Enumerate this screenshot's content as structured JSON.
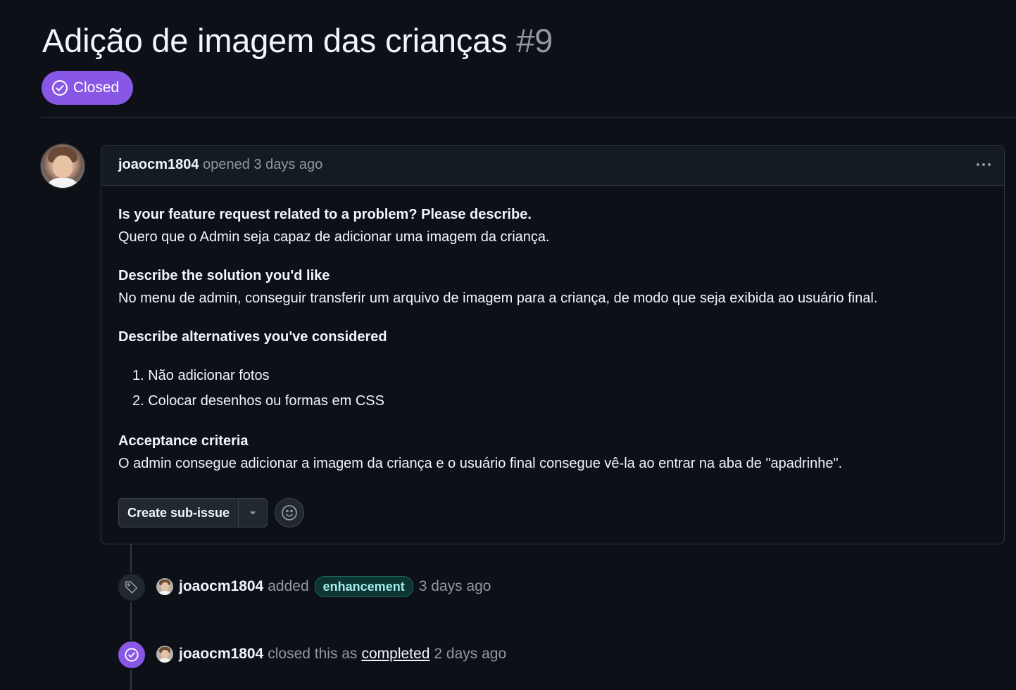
{
  "issue": {
    "title": "Adição de imagem das crianças",
    "number": "#9",
    "state_label": "Closed",
    "state_color": "#8957e5"
  },
  "comment": {
    "author": "joaocm1804",
    "action": "opened",
    "time": "3 days ago",
    "body": {
      "problem_heading": "Is your feature request related to a problem? Please describe.",
      "problem_text": "Quero que o Admin seja capaz de adicionar uma imagem da criança.",
      "solution_heading": "Describe the solution you'd like",
      "solution_text": "No menu de admin, conseguir transferir um arquivo de imagem para a criança, de modo que seja exibida ao usuário final.",
      "alternatives_heading": "Describe alternatives you've considered",
      "alternatives": [
        "1. Não adicionar fotos",
        "2. Colocar desenhos ou formas em CSS"
      ],
      "acceptance_heading": "Acceptance criteria",
      "acceptance_text": "O admin consegue adicionar a imagem da criança e o usuário final consegue vê-la ao entrar na aba de \"apadrinhe\"."
    },
    "create_subissue_label": "Create sub-issue"
  },
  "timeline": [
    {
      "icon": "tag-icon",
      "author": "joaocm1804",
      "action": "added",
      "label": "enhancement",
      "label_color": "#a2eeef",
      "time": "3 days ago"
    },
    {
      "icon": "check-circle-icon",
      "author": "joaocm1804",
      "action": "closed this as",
      "link_text": "completed",
      "time": "2 days ago"
    }
  ]
}
